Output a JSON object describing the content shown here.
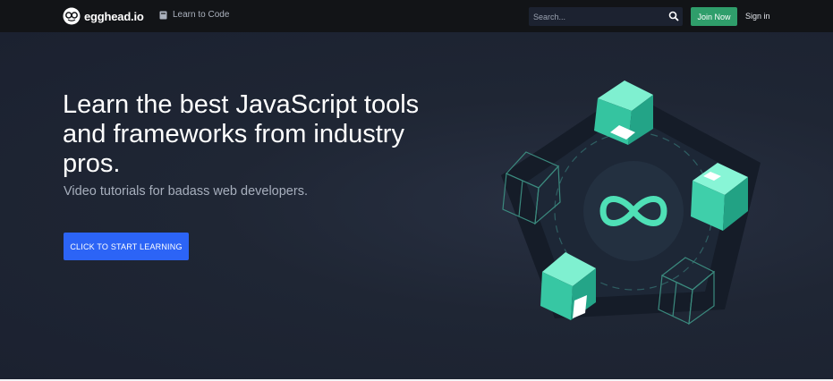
{
  "header": {
    "brand": "egghead.io",
    "learn_link": "Learn to Code",
    "search_placeholder": "Search...",
    "join_label": "Join Now",
    "signin_label": "Sign in"
  },
  "hero": {
    "headline": "Learn the best JavaScript tools and frameworks from industry pros.",
    "subhead": "Video tutorials for badass web developers.",
    "cta_label": "CLICK TO START LEARNING"
  },
  "icons": {
    "logo": "egghead-logo-icon",
    "learn": "book-icon",
    "search": "search-icon",
    "illustration": "infinity-cubes-illustration"
  },
  "colors": {
    "nav_bg": "#121417",
    "hero_bg": "#1f2634",
    "join_green": "#2f9e6b",
    "cta_blue": "#2c64f6",
    "accent_mint": "#4fe0b6"
  }
}
